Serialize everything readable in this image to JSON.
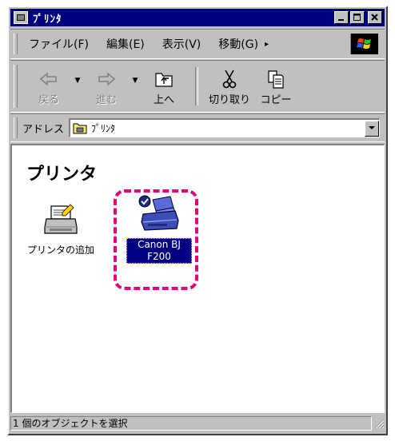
{
  "window": {
    "title": "ﾌﾟﾘﾝﾀ"
  },
  "menubar": {
    "items": [
      {
        "label": "ファイル(F)"
      },
      {
        "label": "編集(E)"
      },
      {
        "label": "表示(V)"
      },
      {
        "label": "移動(G)"
      }
    ]
  },
  "toolbar": {
    "back_label": "戻る",
    "forward_label": "進む",
    "up_label": "上へ",
    "cut_label": "切り取り",
    "copy_label": "コピー"
  },
  "address": {
    "label": "アドレス",
    "value": "ﾌﾟﾘﾝﾀ"
  },
  "content": {
    "heading": "プリンタ",
    "items": [
      {
        "label": "プリンタの追加",
        "icon": "add-printer-icon",
        "selected": false
      },
      {
        "label": "Canon BJ F200",
        "icon": "printer-icon",
        "selected": true
      }
    ]
  },
  "status": {
    "text": "1 個のオブジェクトを選択"
  },
  "colors": {
    "titlebar": "#000080",
    "face": "#c0c0c0",
    "selection": "#000080",
    "highlight_marker": "#e6007e"
  }
}
